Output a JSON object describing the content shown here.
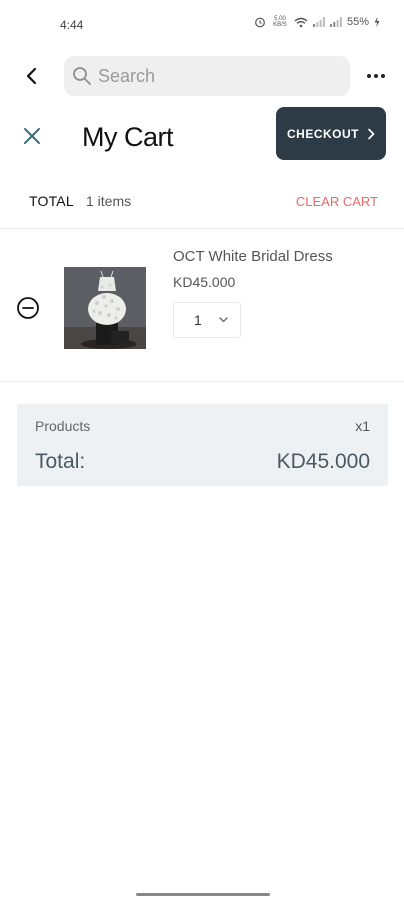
{
  "status_bar": {
    "time": "4:44",
    "speed_top": "5.00",
    "speed_bottom": "KB/S",
    "battery": "55%",
    "icons": [
      "alarm-icon",
      "wifi-icon",
      "signal-icon",
      "signal-icon",
      "battery-icon"
    ]
  },
  "app_bar": {
    "search_placeholder": "Search",
    "icons": [
      "back-arrow-icon",
      "search-icon",
      "more-horizontal-icon"
    ]
  },
  "cart_header": {
    "title": "My Cart",
    "checkout_label": "CHECKOUT",
    "icons": [
      "close-icon",
      "chevron-right-icon"
    ]
  },
  "totals_row": {
    "label": "TOTAL",
    "count": "1 items",
    "clear_label": "CLEAR CART"
  },
  "items": [
    {
      "name": "OCT White Bridal Dress",
      "price": "KD45.000",
      "quantity": "1",
      "image": "white-flower-dress-arrangement"
    }
  ],
  "summary": {
    "products_label": "Products",
    "products_qty": "x1",
    "total_label": "Total:",
    "total_value": "KD45.000"
  },
  "colors": {
    "checkout_bg": "#2d3b47",
    "clear_cart": "#e66a6a",
    "summary_bg": "#eef1f3",
    "summary_text": "#4b5a64",
    "close_icon": "#3c6f77"
  }
}
